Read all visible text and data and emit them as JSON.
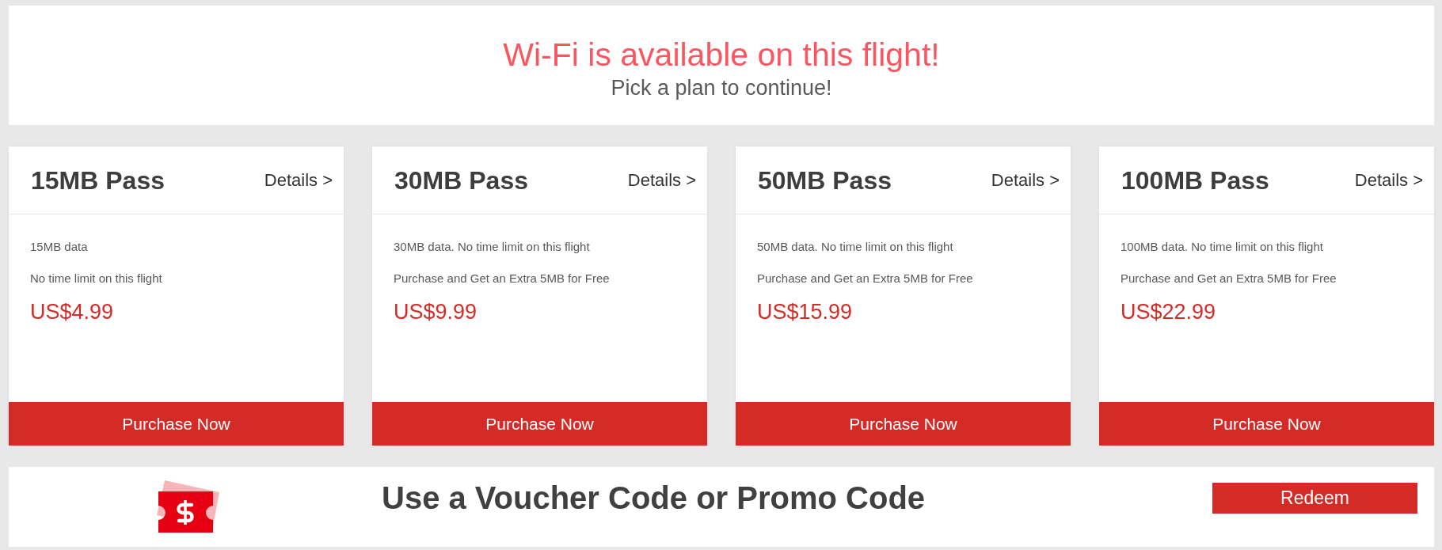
{
  "header": {
    "title": "Wi-Fi is available on this flight!",
    "subtitle": "Pick a plan to continue!"
  },
  "plans": [
    {
      "name": "15MB Pass",
      "details_link": "Details >",
      "description": [
        "15MB data",
        "No time limit on this flight"
      ],
      "price": "US$4.99",
      "button": "Purchase Now"
    },
    {
      "name": "30MB Pass",
      "details_link": "Details >",
      "description": [
        "30MB data. No time limit on this flight",
        "Purchase and Get an Extra 5MB for Free"
      ],
      "price": "US$9.99",
      "button": "Purchase Now"
    },
    {
      "name": "50MB Pass",
      "details_link": "Details >",
      "description": [
        "50MB data. No time limit on this flight",
        "Purchase and Get an Extra 5MB for Free"
      ],
      "price": "US$15.99",
      "button": "Purchase Now"
    },
    {
      "name": "100MB Pass",
      "details_link": "Details >",
      "description": [
        "100MB data. No time limit on this flight",
        "Purchase and Get an Extra 5MB for Free"
      ],
      "price": "US$22.99",
      "button": "Purchase Now"
    }
  ],
  "voucher": {
    "title": "Use a Voucher Code or Promo Code",
    "button": "Redeem"
  }
}
